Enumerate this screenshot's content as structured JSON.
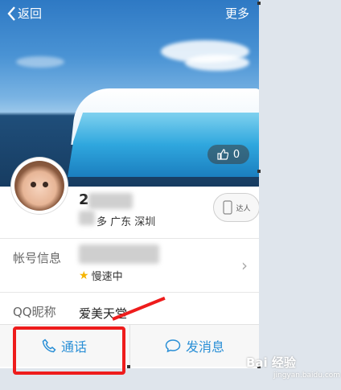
{
  "topbar": {
    "back_label": "返回",
    "more_label": "更多"
  },
  "cover": {
    "like_count": "0"
  },
  "profile": {
    "nickname_visible": "2",
    "location": "多  广东 深圳",
    "badge_label": "达人"
  },
  "rows": {
    "account_label": "帐号信息",
    "speed_label": "慢速中",
    "qqname_label": "QQ昵称",
    "qqname_value": "爱美天堂"
  },
  "actions": {
    "call_label": "通话",
    "message_label": "发消息"
  },
  "watermark": {
    "main": "Bai 经验",
    "sub": "jingyan.baidu.com"
  },
  "colors": {
    "accent": "#2a8fd6",
    "annotation": "#ee1c1c",
    "star": "#f5b400"
  }
}
